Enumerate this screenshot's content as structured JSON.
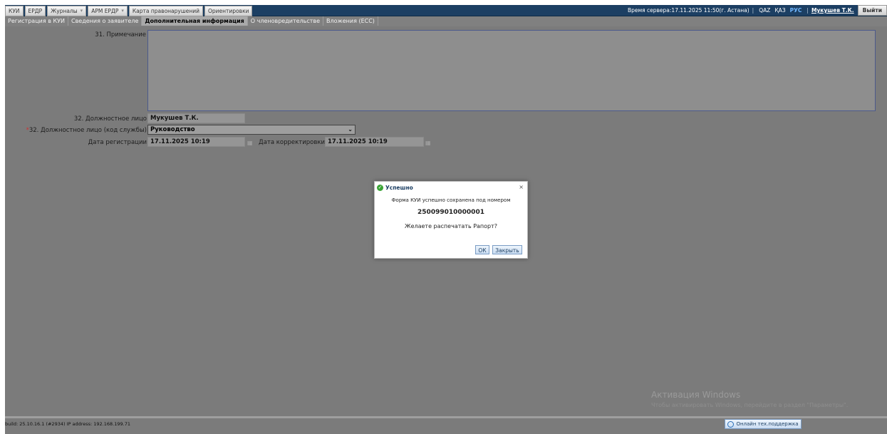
{
  "topbar": {
    "nav": [
      {
        "label": "КУИ",
        "dropdown": false
      },
      {
        "label": "ЕРДР",
        "dropdown": false
      },
      {
        "label": "Журналы",
        "dropdown": true
      },
      {
        "label": "АРМ ЕРДР",
        "dropdown": true
      },
      {
        "label": "Карта правонарушений",
        "dropdown": false
      },
      {
        "label": "Ориентировки",
        "dropdown": false
      }
    ],
    "server_time": "Время сервера:17.11.2025 11:50(г. Астана)",
    "languages": [
      "QAZ",
      "ҚАЗ",
      "РУС"
    ],
    "active_language": "РУС",
    "user": "Мукушев Т.К.",
    "exit_label": "Выйти"
  },
  "tabs": [
    {
      "label": "Регистрация в КУИ",
      "active": false
    },
    {
      "label": "Сведения о заявителе",
      "active": false
    },
    {
      "label": "Дополнительная информация",
      "active": true
    },
    {
      "label": "О членовредительстве",
      "active": false
    },
    {
      "label": "Вложения (ЕСС)",
      "active": false
    }
  ],
  "form": {
    "note_label": "31. Примечание",
    "note_value": "",
    "official_label": "32. Должностное лицо",
    "official_value": "Мукушев Т.К.",
    "service_required_mark": "*",
    "service_label": "32. Должностное лицо (код службы)",
    "service_value": "Руководство",
    "reg_date_label": "Дата регистрации",
    "reg_date_value": "17.11.2025 10:19",
    "corr_date_label": "Дата корректировки",
    "corr_date_value": "17.11.2025 10:19"
  },
  "modal": {
    "title": "Успешно",
    "message": "Форма КУИ успешно сохранена под номером",
    "number": "250099010000001",
    "question": "Желаете распечатать Рапорт?",
    "ok_label": "ОК",
    "close_label": "Закрыть"
  },
  "watermark": {
    "line1": "Активация Windows",
    "line2": "Чтобы активировать Windows, перейдите в раздел \"Параметры\"."
  },
  "footer": {
    "build": "build: 25.10.16.1 (#2934)  IP address: 192.168.199.71",
    "support_label": "Онлайн тех.поддержка"
  },
  "colors": {
    "topbar": "#1c3f63",
    "background": "#7b7b7b",
    "active_language": "#6fb6ff",
    "success": "#3aa335"
  }
}
